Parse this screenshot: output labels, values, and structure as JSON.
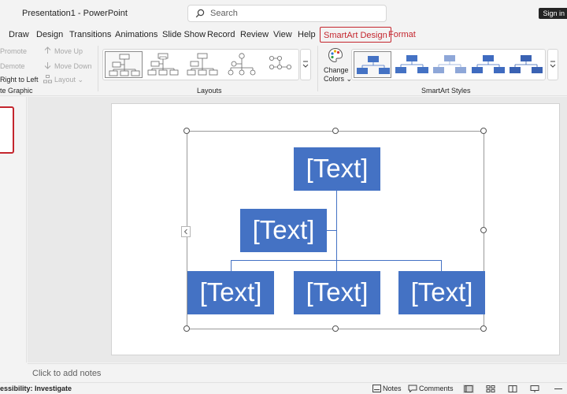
{
  "titlebar": {
    "title": "Presentation1  -  PowerPoint",
    "search_placeholder": "Search",
    "signin_label": "Sign in"
  },
  "tabs": [
    {
      "label": "Draw"
    },
    {
      "label": "Design"
    },
    {
      "label": "Transitions"
    },
    {
      "label": "Animations"
    },
    {
      "label": "Slide Show"
    },
    {
      "label": "Record"
    },
    {
      "label": "Review"
    },
    {
      "label": "View"
    },
    {
      "label": "Help"
    },
    {
      "label": "SmartArt Design",
      "active": true
    },
    {
      "label": "Format"
    }
  ],
  "ribbon": {
    "create_graphic": {
      "promote": "Promote",
      "demote": "Demote",
      "right_to_left": "Right to Left",
      "move_up": "Move Up",
      "move_down": "Move Down",
      "layout": "Layout",
      "group_label": "te Graphic"
    },
    "layouts": {
      "group_label": "Layouts"
    },
    "change_colors": {
      "line1": "Change",
      "line2": "Colors"
    },
    "styles": {
      "group_label": "SmartArt Styles"
    }
  },
  "slide": {
    "boxes": [
      {
        "text": "[Text]",
        "role": "top"
      },
      {
        "text": "[Text]",
        "role": "assistant"
      },
      {
        "text": "[Text]",
        "role": "child-1"
      },
      {
        "text": "[Text]",
        "role": "child-2"
      },
      {
        "text": "[Text]",
        "role": "child-3"
      }
    ],
    "box_color": "#4472c4"
  },
  "notes": {
    "placeholder": "Click to add notes"
  },
  "statusbar": {
    "accessibility": "essibility: Investigate",
    "notes_label": "Notes",
    "comments_label": "Comments"
  },
  "colors": {
    "accent": "#c4262e",
    "smartart_blue": "#4472c4"
  }
}
